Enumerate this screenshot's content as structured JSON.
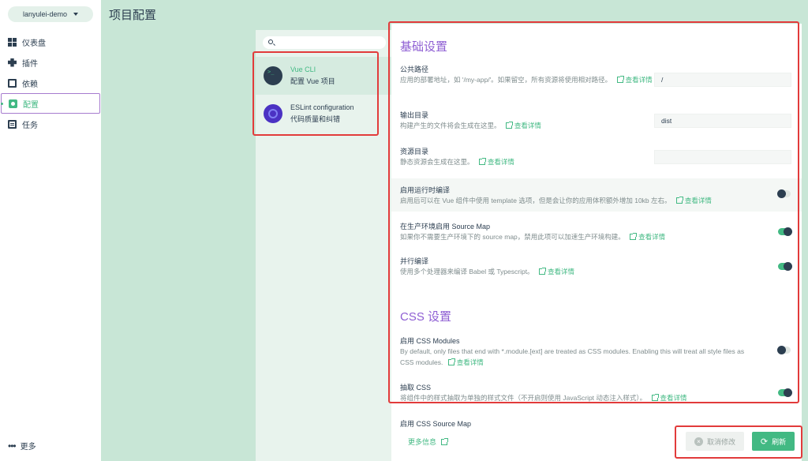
{
  "sidebar": {
    "project": "lanyulei-demo",
    "items": [
      {
        "label": "仪表盘",
        "icon": "dashboard-icon"
      },
      {
        "label": "插件",
        "icon": "puzzle-icon"
      },
      {
        "label": "依赖",
        "icon": "dependencies-icon"
      },
      {
        "label": "配置",
        "icon": "config-icon",
        "active": true
      },
      {
        "label": "任务",
        "icon": "clipboard-icon"
      }
    ],
    "more": "更多"
  },
  "page_title": "项目配置",
  "config_list": {
    "search_placeholder": "",
    "items": [
      {
        "name": "Vue CLI",
        "desc": "配置 Vue 项目",
        "selected": true
      },
      {
        "name": "ESLint configuration",
        "desc": "代码质量和纠错",
        "selected": false
      }
    ]
  },
  "settings": {
    "basic_title": "基础设置",
    "css_title": "CSS 设置",
    "link_text": "查看详情",
    "public_path": {
      "label": "公共路径",
      "desc": "应用的部署地址，如 '/my-app/'。如果留空，所有资源将使用相对路径。",
      "value": "/"
    },
    "output_dir": {
      "label": "输出目录",
      "desc": "构建产生的文件将会生成在这里。",
      "value": "dist"
    },
    "assets_dir": {
      "label": "资源目录",
      "desc": "静态资源会生成在这里。",
      "value": ""
    },
    "runtime_compiler": {
      "label": "启用运行时编译",
      "desc": "启用后可以在 Vue 组件中使用 template 选项，但是会让你的应用体积额外增加 10kb 左右。",
      "enabled": false
    },
    "prod_source_map": {
      "label": "在生产环境启用 Source Map",
      "desc": "如果你不需要生产环境下的 source map，禁用此项可以加速生产环境构建。",
      "enabled": true
    },
    "parallel": {
      "label": "并行编译",
      "desc": "使用多个处理器来编译 Babel 或 Typescript。",
      "enabled": true
    },
    "css_modules": {
      "label": "启用 CSS Modules",
      "desc": "By default, only files that end with *.module.[ext] are treated as CSS modules. Enabling this will treat all style files as CSS modules.",
      "enabled": false
    },
    "extract_css": {
      "label": "抽取 CSS",
      "desc": "将组件中的样式抽取为单独的样式文件（不开启则使用 JavaScript 动态注入样式）。",
      "enabled": true
    },
    "css_source_map": {
      "label": "启用 CSS Source Map"
    }
  },
  "footer": {
    "more_info": "更多信息",
    "cancel": "取消修改",
    "refresh": "刷新"
  },
  "colors": {
    "accent": "#42b983",
    "title_purple": "#8e5ed3",
    "highlight_red": "#e23b3b",
    "background": "#c8e6d6"
  }
}
